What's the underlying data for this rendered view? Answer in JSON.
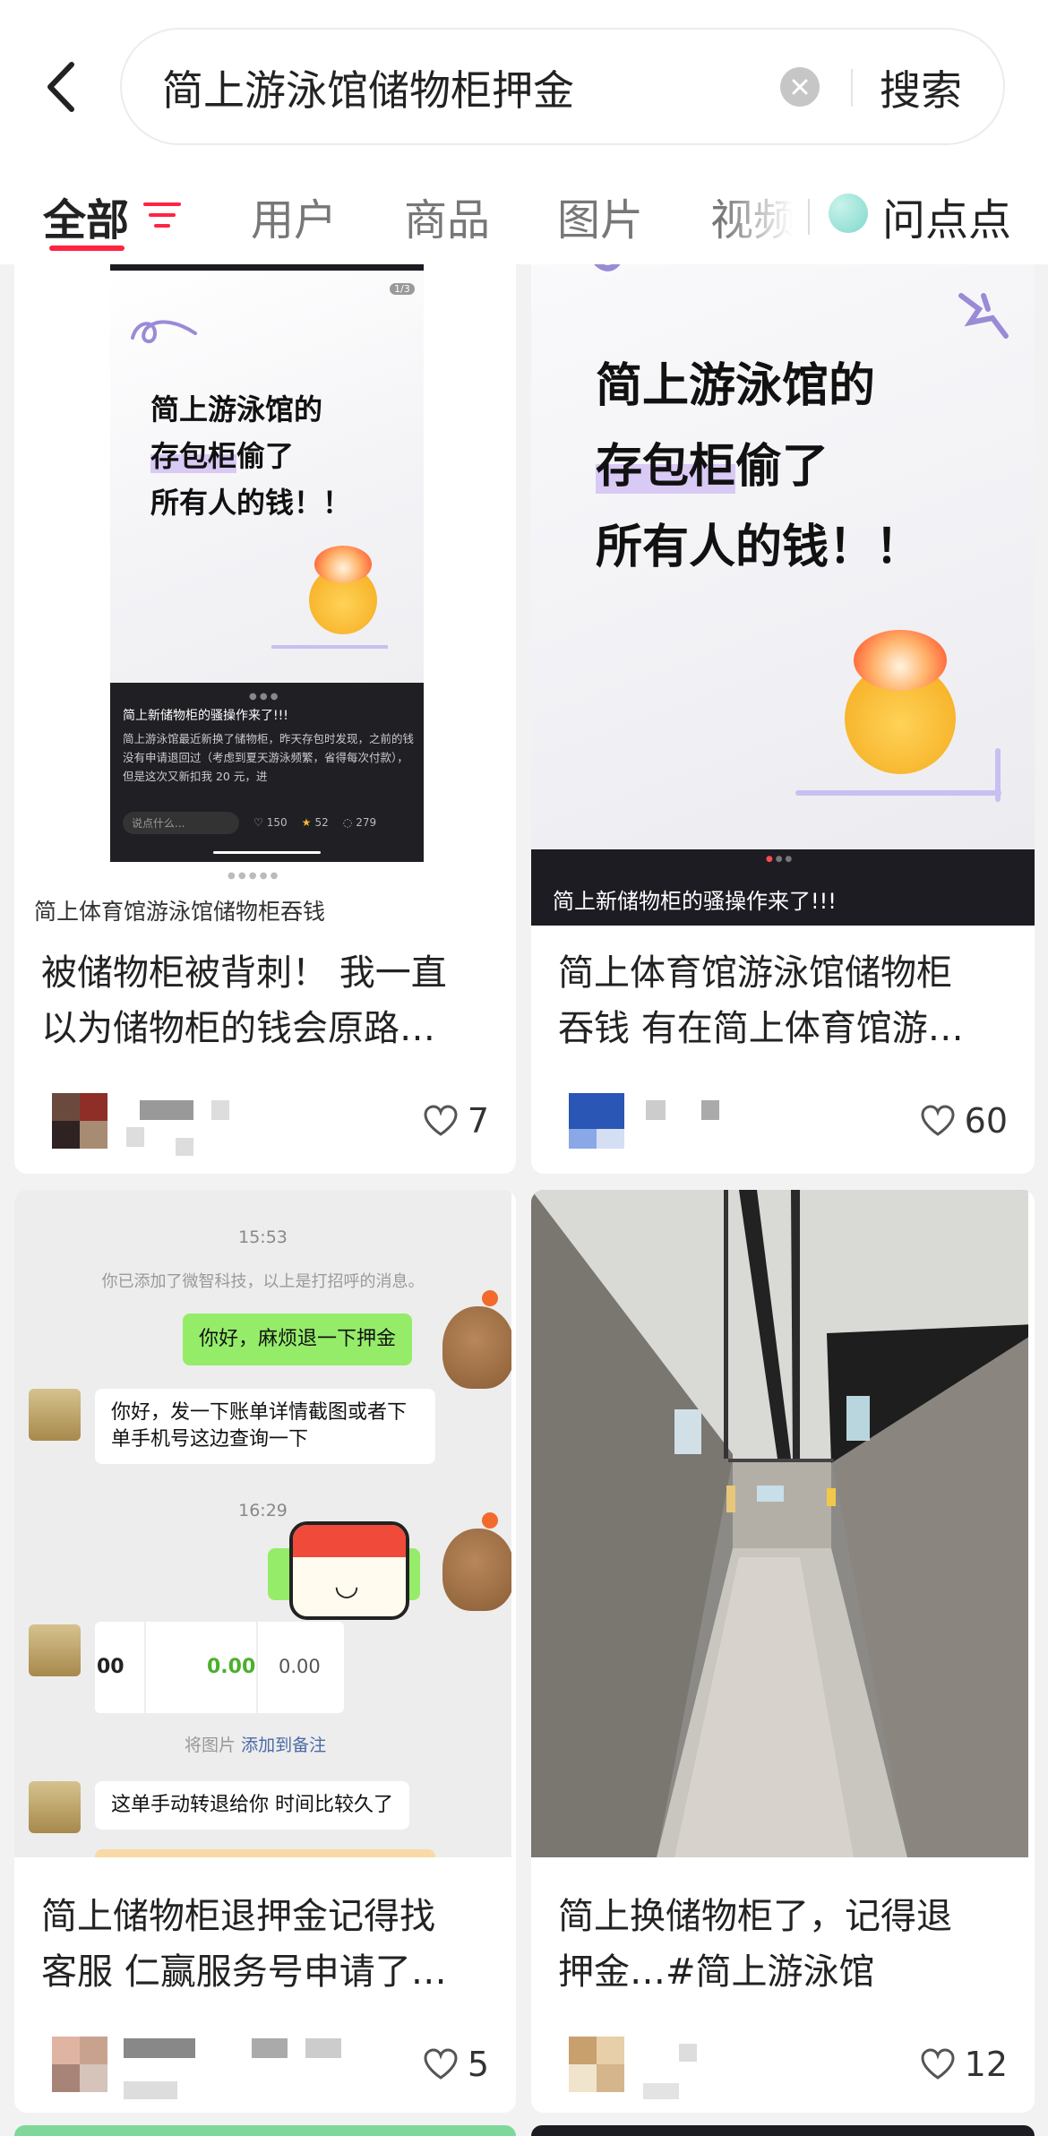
{
  "search": {
    "query": "简上游泳馆储物柜押金",
    "button_label": "搜索"
  },
  "tabs": [
    {
      "label": "全部",
      "active": true
    },
    {
      "label": "用户"
    },
    {
      "label": "商品"
    },
    {
      "label": "图片"
    },
    {
      "label": "视频"
    },
    {
      "label": "问点点"
    }
  ],
  "colors": {
    "accent": "#ff2442",
    "chat_green": "#95ec69",
    "highlight_purple": "#d9c9f5"
  },
  "cards": [
    {
      "image": {
        "page_indicator": "1/3",
        "headline": [
          "简上游泳馆的",
          "存包柜",
          "偷了",
          "所有人的钱！！"
        ],
        "panel_title": "简上新储物柜的骚操作来了!!!",
        "panel_body": "简上游泳馆最近新换了储物柜，昨天存包时发现，之前的钱没有申请退回过（考虑到夏天游泳频繁，省得每次付款），但是这次又新扣我 20 元，进",
        "comment_placeholder": "说点什么...",
        "likes": "150",
        "stars": "52",
        "comments": "279"
      },
      "caption": "简上体育馆游泳馆储物柜吞钱",
      "title_lines": [
        "被储物柜被背刺！ 我一直",
        "以为储物柜的钱会原路…"
      ],
      "likes": "7"
    },
    {
      "image": {
        "headline": [
          "简上游泳馆的",
          "存包柜",
          "偷了",
          "所有人的钱！！"
        ],
        "banner": "简上新储物柜的骚操作来了!!!"
      },
      "title_lines": [
        "简上体育馆游泳馆储物柜",
        "吞钱 有在简上体育馆游…"
      ],
      "likes": "60"
    },
    {
      "chat": {
        "time1": "15:53",
        "system_msg": "你已添加了微智科技，以上是打招呼的消息。",
        "msg_me_1": "你好，麻烦退一下押金",
        "msg_them_1": "你好，发一下账单详情截图或者下单手机号这边查询一下",
        "time2": "16:29",
        "amount1": "00",
        "amount2": "0.00",
        "amount3": "0.00",
        "img_note": "将图片",
        "add_note": "添加到备注",
        "msg_them_2": "这单手动转退给你 时间比较久了"
      },
      "title_lines": [
        "简上储物柜退押金记得找",
        "客服 仁赢服务号申请了…"
      ],
      "likes": "5"
    },
    {
      "title_lines": [
        "简上换储物柜了，记得退",
        "押金…#简上游泳馆"
      ],
      "likes": "12"
    }
  ]
}
